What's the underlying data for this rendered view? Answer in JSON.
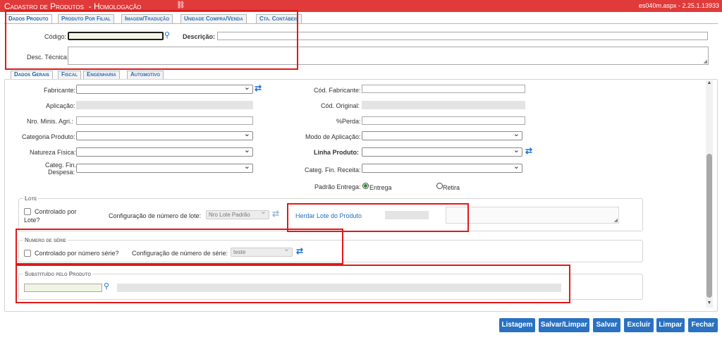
{
  "titlebar": {
    "title": "Cadastro de Produtos",
    "env": "- Homologação",
    "version": "es040m.aspx - 2.25.1.13933"
  },
  "tabs": [
    "Dados Produto",
    "Produto Por Filial",
    "Imagem/Tradução",
    "Unidade Compra/Venda",
    "Cta. Contábeis"
  ],
  "header": {
    "codigo_label": "Código:",
    "descricao_label": "Descrição:",
    "desc_tecnica_label": "Desc. Técnica:"
  },
  "subtabs": [
    "Dados Gerais",
    "Fiscal",
    "Engenharia",
    "Automotivo"
  ],
  "form": {
    "fabricante": "Fabricante:",
    "aplicacao": "Aplicação:",
    "nro_minis": "Nro. Minis. Agri.:",
    "categoria": "Categoria Produto:",
    "natureza": "Natureza Física:",
    "categ_fin_despesa_1": "Categ. Fin.",
    "categ_fin_despesa_2": "Despesa:",
    "cod_fabricante": "Cód. Fabricante:",
    "cod_original": "Cód. Original:",
    "perda": "%Perda:",
    "modo_aplicacao": "Modo de Aplicação:",
    "linha_produto": "Linha Produto:",
    "categ_fin_receita": "Categ. Fin. Receita:",
    "padrao_entrega": "Padrão Entrega:",
    "entrega": "Entrega",
    "retira": "Retira"
  },
  "lote": {
    "legend": "Lote",
    "controlado_1": "Controlado por",
    "controlado_2": "Lote?",
    "config_label": "Configuração de número de lote:",
    "config_value": "Nro Lote Padrão",
    "herdar_link": "Herdar Lote do Produto"
  },
  "serie": {
    "legend": "Numero de série",
    "controlado": "Controlado por número série?",
    "config_label": "Configuração de número de série:",
    "config_value": "teste"
  },
  "substituido": {
    "legend": "Substituído pelo Produto"
  },
  "buttons": [
    "Listagem",
    "Salvar/Limpar",
    "Salvar",
    "Excluir",
    "Limpar",
    "Fechar"
  ],
  "colors": {
    "titlebar": "#e03a3a",
    "button": "#2a71c2",
    "highlight": "#e21818"
  }
}
